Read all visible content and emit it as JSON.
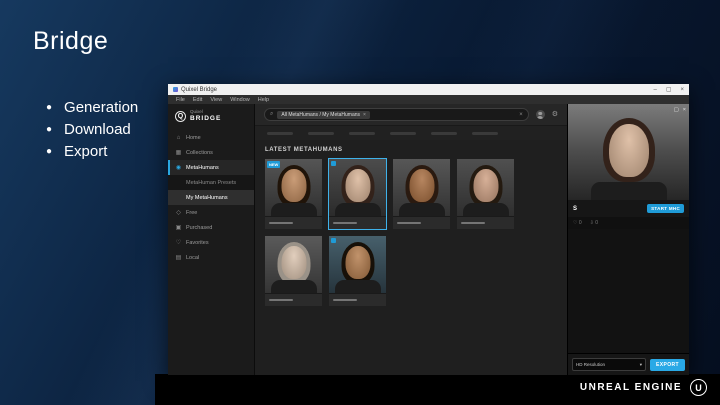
{
  "slide": {
    "title": "Bridge",
    "bullets": [
      "Generation",
      "Download",
      "Export"
    ],
    "brand": {
      "name": "UNREAL ENGINE",
      "logo_letter": "U"
    }
  },
  "icons": {
    "bullet": "●",
    "search": "⌕",
    "close": "×",
    "minimize": "–",
    "maximize": "▢",
    "gear": "⚙",
    "heart": "♡",
    "download": "⇩",
    "expand": "▢",
    "dropdown": "▾",
    "logo_q": "Q",
    "nav": {
      "home": "⌂",
      "collections": "▦",
      "metahumans": "◉",
      "free": "◇",
      "purchased": "▣",
      "favorites": "♡",
      "local": "▤"
    }
  },
  "window": {
    "title": "Quixel Bridge",
    "menu_items": [
      "File",
      "Edit",
      "View",
      "Window",
      "Help"
    ],
    "sidebar": {
      "logo_top": "Quixel",
      "logo_bottom": "BRIDGE",
      "items": [
        {
          "label": "Home",
          "icon": "home"
        },
        {
          "label": "Collections",
          "icon": "collections"
        },
        {
          "label": "MetaHumans",
          "icon": "metahumans",
          "selected": true
        },
        {
          "label": "MetaHuman Presets",
          "indent": true
        },
        {
          "label": "My MetaHumans",
          "indent": true,
          "active": true
        },
        {
          "label": "Free",
          "icon": "free"
        },
        {
          "label": "Purchased",
          "icon": "purchased"
        },
        {
          "label": "Favorites",
          "icon": "favorites"
        },
        {
          "label": "Local",
          "icon": "local"
        }
      ]
    },
    "search": {
      "chip": "All MetaHumans / My MetaHumans"
    },
    "content": {
      "heading": "LATEST METAHUMANS",
      "cards": [
        {
          "badge": "NEW",
          "skin": "#c08a5e",
          "hair": "#201409",
          "bg_top": "#555555",
          "bg_bottom": "#2f2f2f"
        },
        {
          "selected": true,
          "dot": true,
          "skin": "#d9b598",
          "hair": "#33221a",
          "bg_top": "#4c4c4c",
          "bg_bottom": "#2b2b2b"
        },
        {
          "skin": "#a96f42",
          "hair": "#2a1a10",
          "bg_top": "#575757",
          "bg_bottom": "#323232"
        },
        {
          "skin": "#cfa184",
          "hair": "#241a10",
          "bg_top": "#505050",
          "bg_bottom": "#2e2e2e"
        },
        {
          "skin": "#dcc5b0",
          "hair": "#9a9288",
          "bg_top": "#5a5a5a",
          "bg_bottom": "#343434"
        },
        {
          "dot": true,
          "skin": "#b57e4f",
          "hair": "#171008",
          "bg_top": "#47606c",
          "bg_bottom": "#26343c"
        }
      ]
    },
    "detail": {
      "name": "S",
      "start_button": "START MHC",
      "stat_favorites": "0",
      "stat_downloads": "0",
      "resolution_label": "HD Resolution",
      "export_button": "EXPORT"
    }
  },
  "colors": {
    "accent": "#29a9e6",
    "selection": "#3fb2ea"
  }
}
